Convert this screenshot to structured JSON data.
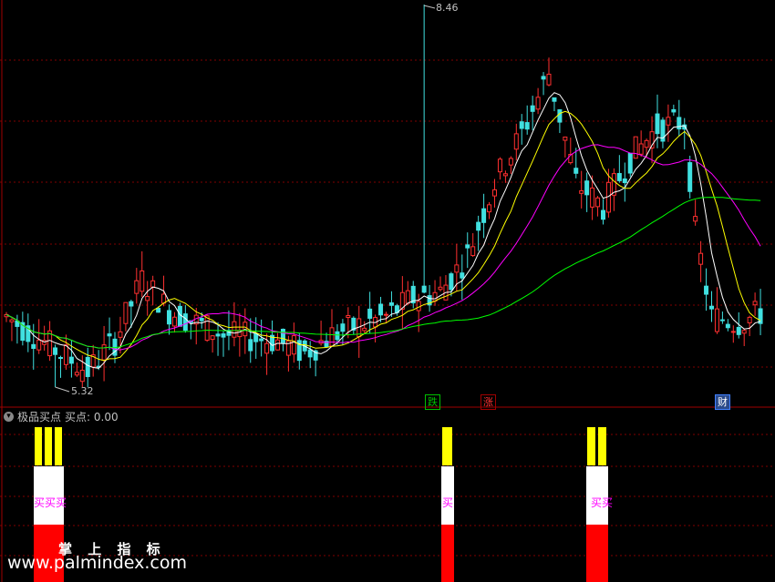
{
  "main_chart": {
    "price_high_label": "8.46",
    "price_low_label": "5.32",
    "markers": [
      {
        "text": "跌",
        "color": "#00c000"
      },
      {
        "text": "涨",
        "color": "#ff3030"
      },
      {
        "text": "财",
        "color": "#4080ff"
      }
    ]
  },
  "indicator": {
    "name": "极品买点",
    "value_label": "买点: 0.00",
    "signals": [
      {
        "text": "买买买",
        "count": 3
      },
      {
        "text": "买",
        "count": 1
      },
      {
        "text": "买买",
        "count": 2
      }
    ]
  },
  "watermark": {
    "title": "掌 上 指 标",
    "url": "www.palmindex.com"
  },
  "chart_data": {
    "type": "candlestick",
    "y_range": [
      5.32,
      8.46
    ],
    "high": 8.46,
    "low": 5.32,
    "series": [
      {
        "name": "MA5",
        "color": "#ffffff"
      },
      {
        "name": "MA10",
        "color": "#ffff00"
      },
      {
        "name": "MA20",
        "color": "#ff00ff"
      },
      {
        "name": "MA60",
        "color": "#00ff00"
      }
    ],
    "colors": {
      "up": "#ff3030",
      "down": "#40e0e0",
      "grid": "#800000"
    }
  }
}
